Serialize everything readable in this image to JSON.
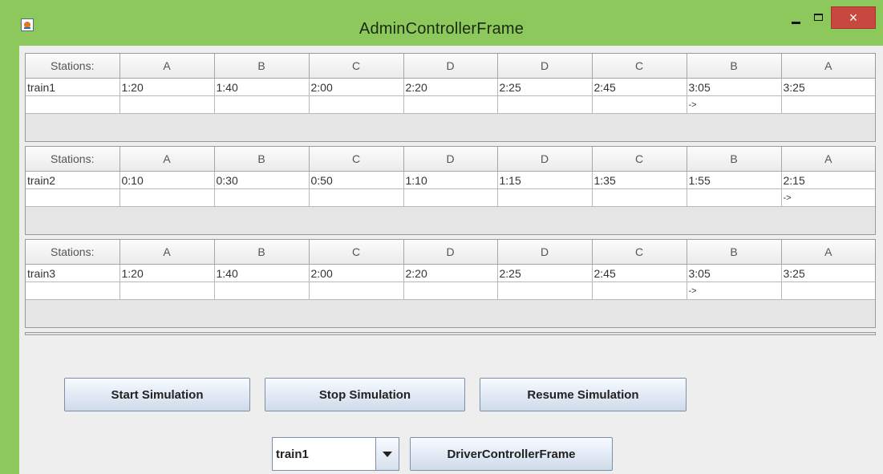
{
  "window": {
    "title": "AdminControllerFrame",
    "icon": "java-cup-icon",
    "controls": {
      "minimize": "minimize-icon",
      "maximize": "maximize-icon",
      "close": "×"
    }
  },
  "schedules": [
    {
      "header": [
        "Stations:",
        "A",
        "B",
        "C",
        "D",
        "D",
        "C",
        "B",
        "A"
      ],
      "times": [
        "train1",
        "1:20",
        "1:40",
        "2:00",
        "2:20",
        "2:25",
        "2:45",
        "3:05",
        "3:25"
      ],
      "arrows": [
        "",
        "",
        "",
        "",
        "",
        "",
        "",
        "->",
        ""
      ]
    },
    {
      "header": [
        "Stations:",
        "A",
        "B",
        "C",
        "D",
        "D",
        "C",
        "B",
        "A"
      ],
      "times": [
        "train2",
        "0:10",
        "0:30",
        "0:50",
        "1:10",
        "1:15",
        "1:35",
        "1:55",
        "2:15"
      ],
      "arrows": [
        "",
        "",
        "",
        "",
        "",
        "",
        "",
        "",
        "->"
      ]
    },
    {
      "header": [
        "Stations:",
        "A",
        "B",
        "C",
        "D",
        "D",
        "C",
        "B",
        "A"
      ],
      "times": [
        "train3",
        "1:20",
        "1:40",
        "2:00",
        "2:20",
        "2:25",
        "2:45",
        "3:05",
        "3:25"
      ],
      "arrows": [
        "",
        "",
        "",
        "",
        "",
        "",
        "",
        "->",
        ""
      ]
    }
  ],
  "buttons": {
    "start": "Start Simulation",
    "stop": "Stop Simulation",
    "resume": "Resume Simulation",
    "driver": "DriverControllerFrame"
  },
  "train_select": {
    "value": "train1"
  },
  "colors": {
    "titlebar": "#8dc85c",
    "close": "#c7483f",
    "button": "#dbe5f1"
  }
}
